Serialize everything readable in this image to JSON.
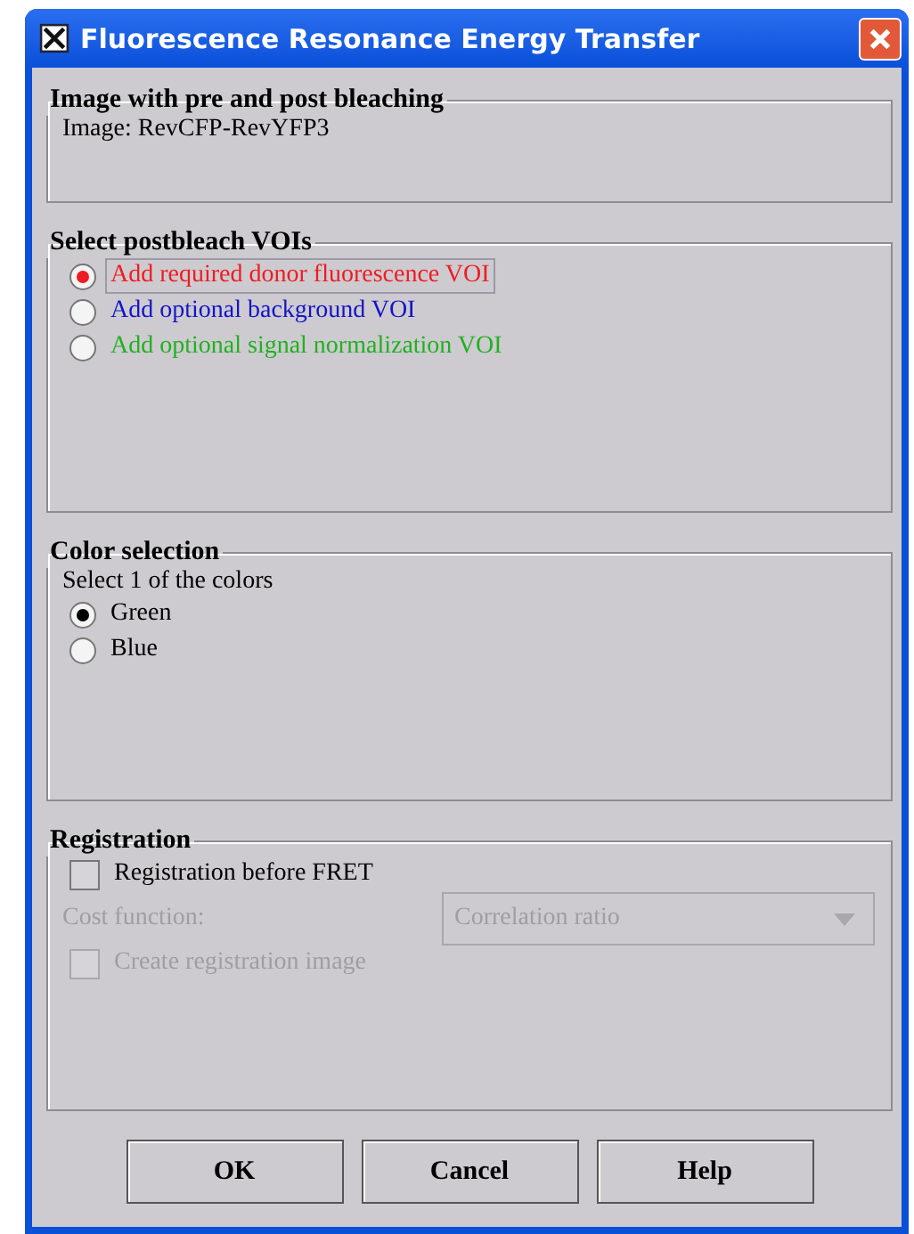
{
  "window": {
    "title": "Fluorescence Resonance Energy Transfer"
  },
  "image_group": {
    "title": "Image with pre and post bleaching",
    "text": "Image: RevCFP-RevYFP3"
  },
  "voi_group": {
    "title": "Select postbleach VOIs",
    "options": [
      {
        "label": "Add required donor fluorescence VOI",
        "color": "#ee1c24",
        "selected": true
      },
      {
        "label": "Add optional background VOI",
        "color": "#1414c8",
        "selected": false
      },
      {
        "label": "Add optional signal normalization VOI",
        "color": "#22b022",
        "selected": false
      }
    ]
  },
  "color_group": {
    "title": "Color selection",
    "prompt": "Select 1 of the colors",
    "options": [
      {
        "label": "Green",
        "selected": true
      },
      {
        "label": "Blue",
        "selected": false
      }
    ]
  },
  "registration_group": {
    "title": "Registration",
    "register_checkbox": {
      "label": "Registration before FRET",
      "checked": false,
      "disabled": false
    },
    "cost_function": {
      "label": "Cost function:",
      "value": "Correlation ratio",
      "disabled": true
    },
    "image_checkbox": {
      "label": "Create registration image",
      "checked": false,
      "disabled": true
    }
  },
  "buttons": [
    "OK",
    "Cancel",
    "Help"
  ]
}
